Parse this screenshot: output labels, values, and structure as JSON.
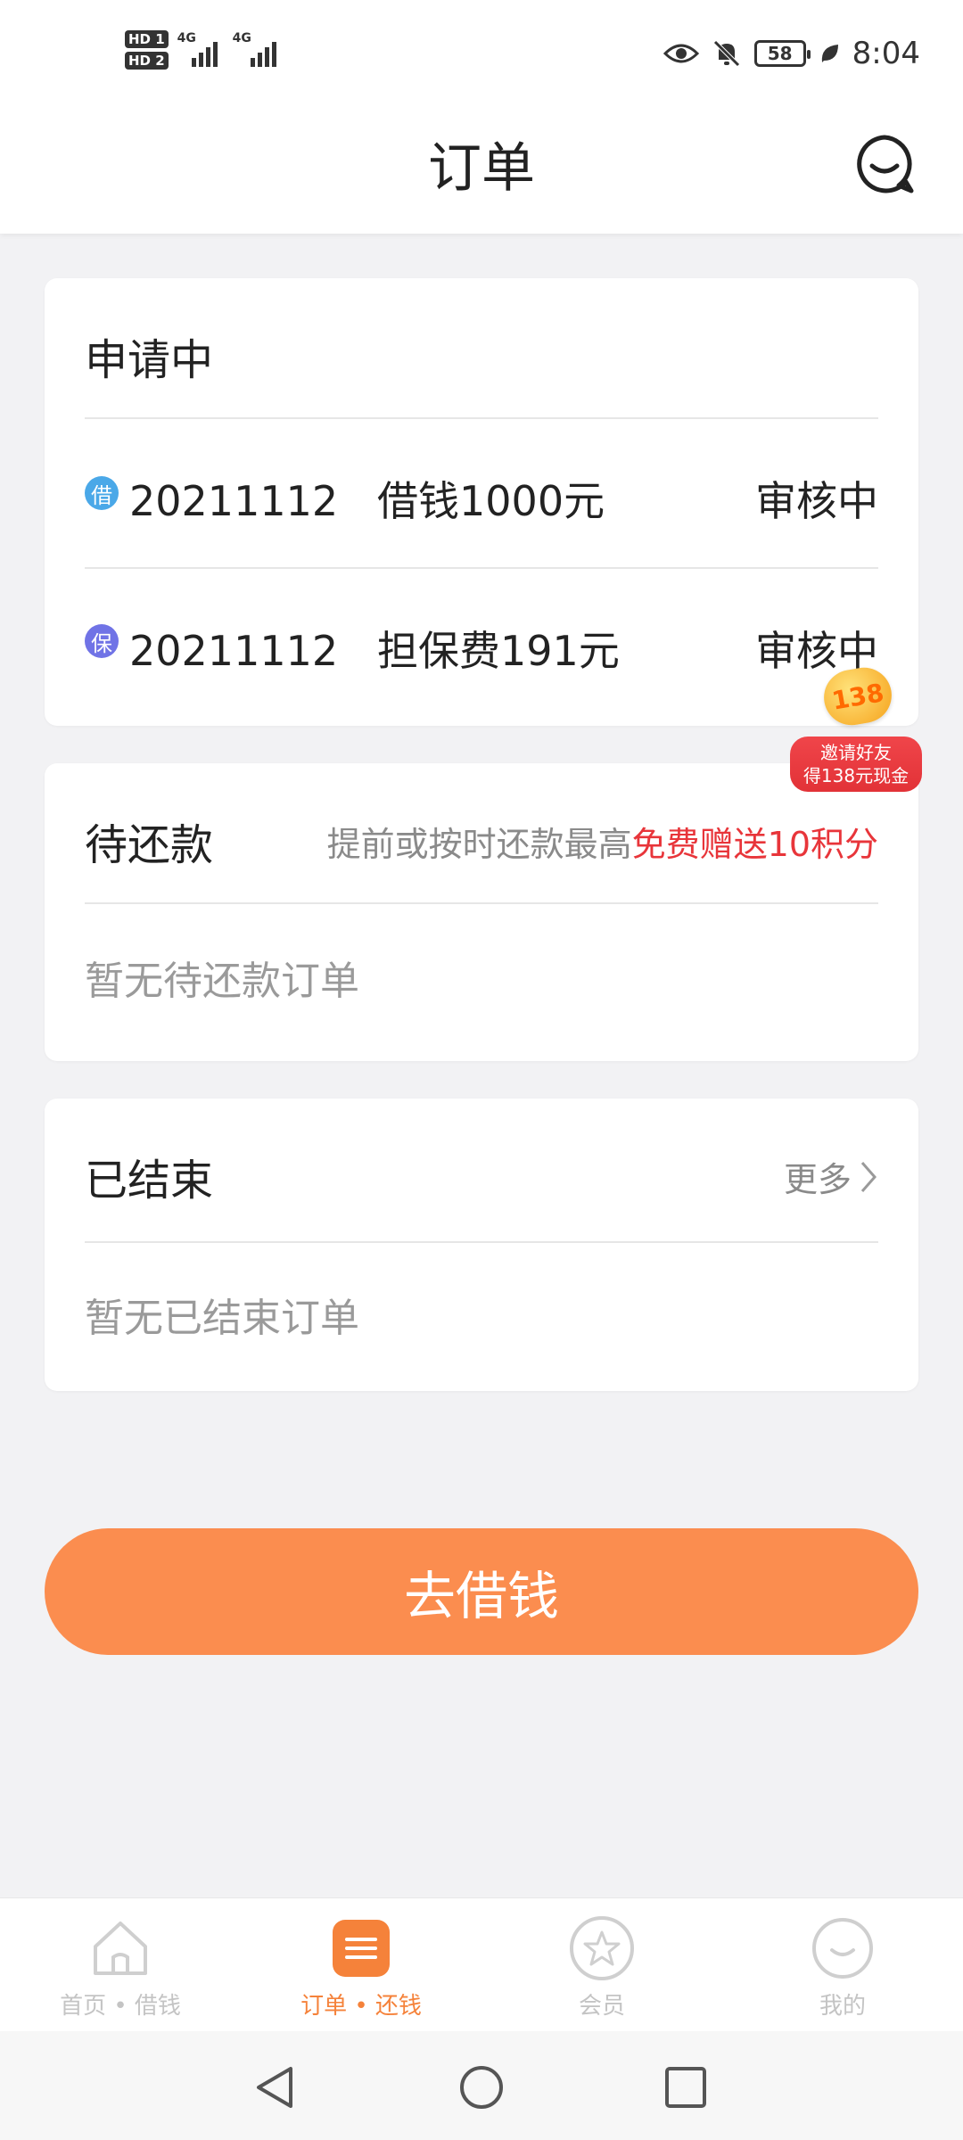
{
  "status_bar": {
    "sim1": "HD 1",
    "sim2": "HD 2",
    "network1": "4G",
    "network2": "4G",
    "battery": "58",
    "time": "8:04",
    "icons": [
      "eye-icon",
      "bell-off-icon",
      "battery-icon",
      "leaf-icon"
    ]
  },
  "header": {
    "title": "订单",
    "chat_icon": "chat-bubble-icon"
  },
  "applying": {
    "title": "申请中",
    "rows": [
      {
        "badge": "借",
        "badge_color": "#4aa8e8",
        "date": "20211112",
        "desc": "借钱1000元",
        "status": "审核中"
      },
      {
        "badge": "保",
        "badge_color": "#7073e6",
        "date": "20211112",
        "desc": "担保费191元",
        "status": "审核中"
      }
    ]
  },
  "pending": {
    "title": "待还款",
    "hint_prefix": "提前或按时还款最高",
    "hint_highlight": "免费赠送10积分",
    "empty": "暂无待还款订单"
  },
  "finished": {
    "title": "已结束",
    "more": "更多",
    "empty": "暂无已结束订单"
  },
  "promo": {
    "amount": "138",
    "line1": "邀请好友",
    "line2": "得138元现金"
  },
  "cta": {
    "label": "去借钱"
  },
  "tabs": [
    {
      "label": "首页 • 借钱",
      "icon": "home-icon",
      "active": false
    },
    {
      "label": "订单 • 还钱",
      "icon": "orders-icon",
      "active": true
    },
    {
      "label": "会员",
      "icon": "star-icon",
      "active": false
    },
    {
      "label": "我的",
      "icon": "profile-icon",
      "active": false
    }
  ],
  "colors": {
    "accent": "#fb8d4f",
    "active_tab": "#f5823a",
    "highlight": "#e8353a"
  }
}
